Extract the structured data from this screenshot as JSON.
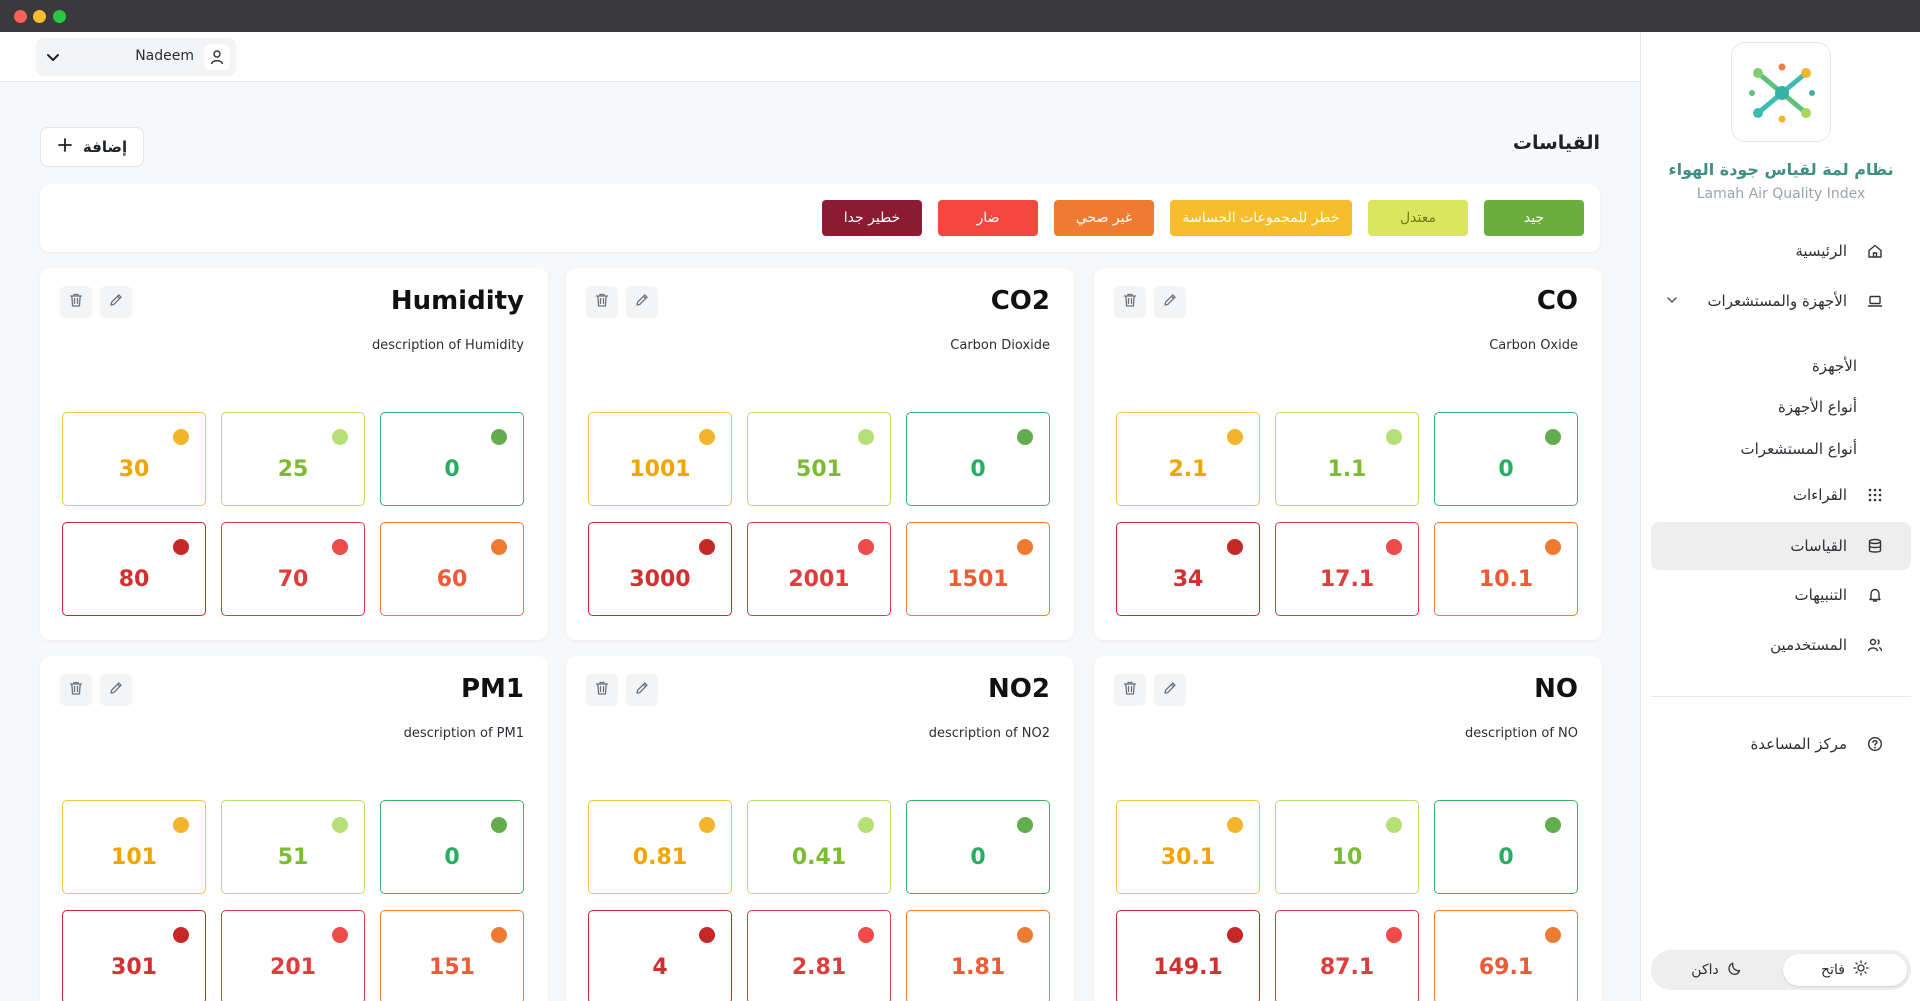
{
  "app": {
    "brand_title": "نظام لمة لقياس جودة الهواء",
    "brand_subtitle": "Lamah Air Quality Index"
  },
  "user": {
    "name": "Nadeem"
  },
  "sidebar": {
    "items": [
      {
        "label": "الرئيسية",
        "icon": "home-icon"
      },
      {
        "label": "الأجهزة والمستشعرات",
        "icon": "laptop-icon"
      },
      {
        "label": "القراءات",
        "icon": "grid-icon"
      },
      {
        "label": "القياسات",
        "icon": "database-icon",
        "active": true
      },
      {
        "label": "التنبيهات",
        "icon": "bell-icon"
      },
      {
        "label": "المستخدمين",
        "icon": "users-icon"
      }
    ],
    "subitems": [
      {
        "label": "الأجهزة"
      },
      {
        "label": "أنواع الأجهزة"
      },
      {
        "label": "أنواع المستشعرات"
      }
    ],
    "help": {
      "label": "مركز المساعدة",
      "icon": "help-icon"
    }
  },
  "theme": {
    "light": "فاتح",
    "dark": "داكن"
  },
  "main": {
    "page_title": "القياسات",
    "add_label": "إضافة"
  },
  "legend": [
    {
      "label": "جيد",
      "color": "#6aaf3d"
    },
    {
      "label": "معتدل",
      "color": "#dce55e"
    },
    {
      "label": "خطر للمجموعات الحساسة",
      "color": "#f7bd2d"
    },
    {
      "label": "غير صحي",
      "color": "#ef7b32"
    },
    {
      "label": "ضار",
      "color": "#f4483e"
    },
    {
      "label": "خطير جدا",
      "color": "#8c1a32"
    }
  ],
  "level_colors": {
    "good": {
      "border": "#3eb36a",
      "dot": "#62ad4e",
      "text": "#27ae60"
    },
    "moderate": {
      "border": "#b8de6f",
      "dot": "#b6e075",
      "text": "#7cbc32"
    },
    "sensitive": {
      "border": "#f3c443",
      "dot": "#f3b52c",
      "text": "#f0a500"
    },
    "unhealthy": {
      "border": "#ef7b32",
      "dot": "#ef7b32",
      "text": "#ef5a35"
    },
    "harmful": {
      "border": "#e33b3b",
      "dot": "#f04a4a",
      "text": "#e23b3b"
    },
    "very_harmful": {
      "border": "#c62828",
      "dot": "#c62828",
      "text": "#d32f2f"
    }
  },
  "measurements": [
    {
      "name": "CO",
      "description": "Carbon Oxide",
      "levels": [
        "0",
        "1.1",
        "2.1",
        "10.1",
        "17.1",
        "34"
      ]
    },
    {
      "name": "CO2",
      "description": "Carbon Dioxide",
      "levels": [
        "0",
        "501",
        "1001",
        "1501",
        "2001",
        "3000"
      ]
    },
    {
      "name": "Humidity",
      "description": "description of Humidity",
      "levels": [
        "0",
        "25",
        "30",
        "60",
        "70",
        "80"
      ]
    },
    {
      "name": "NO",
      "description": "description of NO",
      "levels": [
        "0",
        "10",
        "30.1",
        "69.1",
        "87.1",
        "149.1"
      ]
    },
    {
      "name": "NO2",
      "description": "description of NO2",
      "levels": [
        "0",
        "0.41",
        "0.81",
        "1.81",
        "2.81",
        "4"
      ]
    },
    {
      "name": "PM1",
      "description": "description of PM1",
      "levels": [
        "0",
        "51",
        "101",
        "151",
        "201",
        "301"
      ]
    }
  ]
}
